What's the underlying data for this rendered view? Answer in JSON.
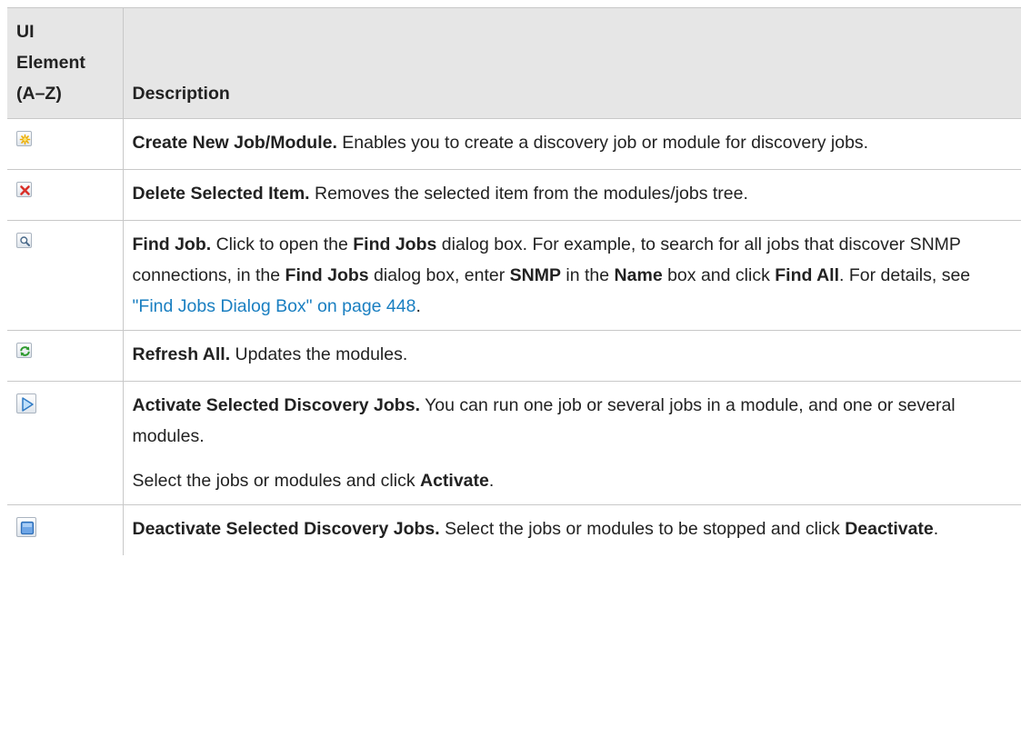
{
  "header": {
    "col1_line1": "UI",
    "col1_line2": "Element",
    "col1_line3": "(A–Z)",
    "col2": "Description"
  },
  "rows": [
    {
      "icon": "create-new-icon",
      "title": "Create New Job/Module.",
      "text": " Enables you to create a discovery job or module for discovery jobs."
    },
    {
      "icon": "delete-icon",
      "title": "Delete Selected Item.",
      "text": " Removes the selected item from the modules/jobs tree."
    },
    {
      "icon": "search-icon",
      "title": "Find Job.",
      "t1": " Click to open the ",
      "b1": "Find Jobs",
      "t2": " dialog box. For example, to search for all jobs that discover SNMP connections, in the ",
      "b2": "Find Jobs",
      "t3": " dialog box, enter ",
      "b3": "SNMP",
      "t4": " in the ",
      "b4": "Name",
      "t5": " box and click ",
      "b5": "Find All",
      "t6": ". For details, see ",
      "link": "\"Find Jobs Dialog Box\" on page 448",
      "t7": "."
    },
    {
      "icon": "refresh-icon",
      "title": "Refresh All.",
      "text": " Updates the modules."
    },
    {
      "icon": "play-icon",
      "title": "Activate Selected Discovery Jobs.",
      "text": " You can run one job or several jobs in a module, and one or several modules.",
      "p2_text": "Select the jobs or modules and click ",
      "p2_bold": "Activate",
      "p2_end": "."
    },
    {
      "icon": "stop-icon",
      "title": "Deactivate Selected Discovery Jobs.",
      "t1": " Select the jobs or modules to be stopped and click ",
      "b1": "Deactivate",
      "t2": "."
    }
  ],
  "colors": {
    "header_bg": "#e6e6e6",
    "border": "#c8c8c8",
    "link": "#1a7fc1",
    "text": "#222222"
  }
}
